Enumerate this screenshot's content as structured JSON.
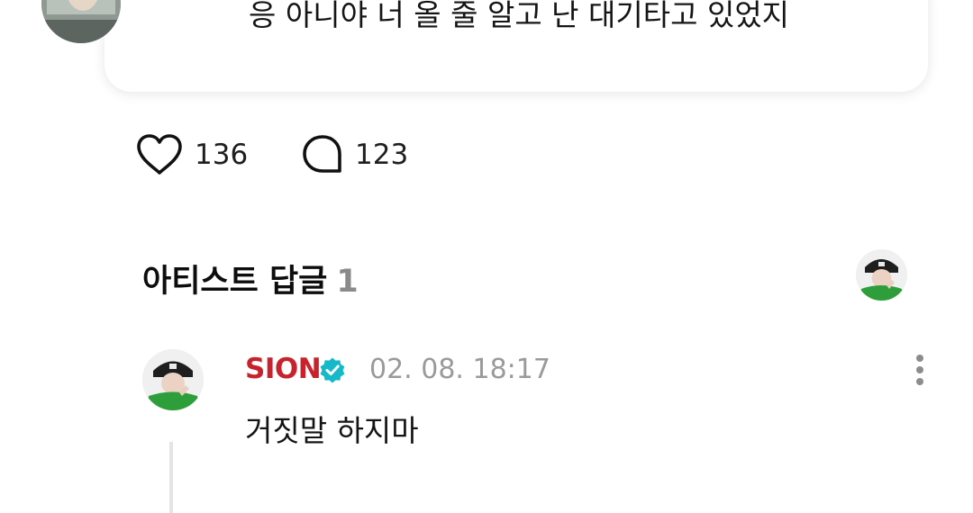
{
  "comment": {
    "text": "응 아니야 너 올 줄 알고 난 대기타고 있었지",
    "avatar_icon": "user-photo-avatar"
  },
  "actions": {
    "like_count": "136",
    "reply_count": "123",
    "like_icon": "heart-outline-icon",
    "reply_icon": "speech-bubble-icon"
  },
  "section": {
    "title": "아티스트 답글",
    "count": "1"
  },
  "reply": {
    "author": "SION",
    "timestamp": "02. 08. 18:17",
    "text": "거짓말 하지마",
    "verified_color": "#16b9c8",
    "author_color": "#c8232c"
  },
  "colors": {
    "background": "#ffffff",
    "muted": "#9a9a9a",
    "accent_green": "#2e9e3a"
  }
}
